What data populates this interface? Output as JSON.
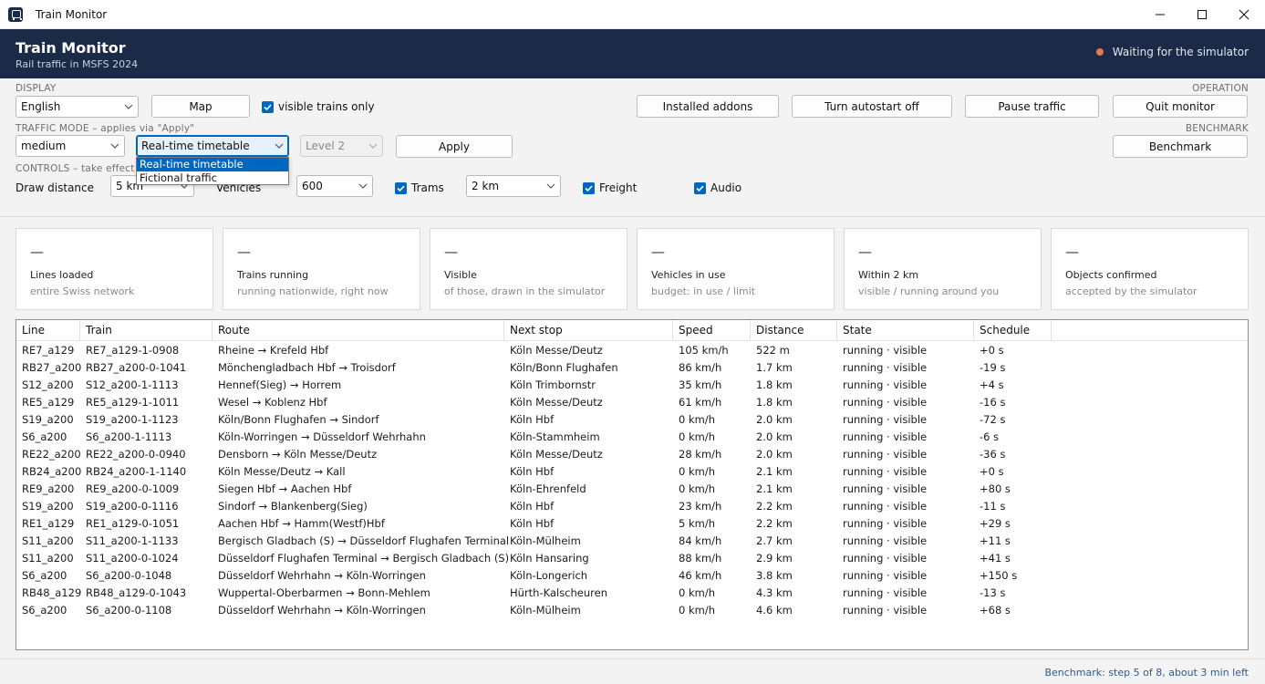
{
  "window": {
    "title": "Train Monitor"
  },
  "header": {
    "title": "Train Monitor",
    "subtitle": "Rail traffic in MSFS 2024",
    "status": "Waiting for the simulator",
    "status_color": "#e8774f",
    "background": "#1a2a47"
  },
  "display": {
    "section_label": "DISPLAY",
    "language": "English",
    "map_button": "Map",
    "visible_only_label": "visible trains only",
    "visible_only_checked": true
  },
  "operation": {
    "section_label": "OPERATION",
    "installed_addons": "Installed addons",
    "autostart": "Turn autostart off",
    "pause": "Pause traffic",
    "quit": "Quit monitor"
  },
  "benchmark": {
    "section_label": "BENCHMARK",
    "button": "Benchmark"
  },
  "traffic_mode": {
    "section_label": "TRAFFIC MODE – applies via \"Apply\"",
    "density": "medium",
    "mode": "Real-time timetable",
    "mode_options": [
      "Real-time timetable",
      "Fictional traffic"
    ],
    "level": "Level 2",
    "apply_button": "Apply"
  },
  "controls": {
    "section_label": "CONTROLS – take effect in",
    "draw_distance_label": "Draw distance",
    "draw_distance": "5 km",
    "vehicles_label": "Vehicles",
    "vehicles": "600",
    "trams_label": "Trams",
    "trams_checked": true,
    "radius": "2 km",
    "freight_label": "Freight",
    "freight_checked": true,
    "audio_label": "Audio",
    "audio_checked": true
  },
  "cards": [
    {
      "value": "—",
      "label": "Lines loaded",
      "sub": "entire Swiss network"
    },
    {
      "value": "—",
      "label": "Trains running",
      "sub": "running nationwide, right now"
    },
    {
      "value": "—",
      "label": "Visible",
      "sub": "of those, drawn in the simulator"
    },
    {
      "value": "—",
      "label": "Vehicles in use",
      "sub": "budget: in use / limit"
    },
    {
      "value": "—",
      "label": "Within 2 km",
      "sub": "visible / running around you"
    },
    {
      "value": "—",
      "label": "Objects confirmed",
      "sub": "accepted by the simulator"
    }
  ],
  "table": {
    "columns": [
      "Line",
      "Train",
      "Route",
      "Next stop",
      "Speed",
      "Distance",
      "State",
      "Schedule"
    ],
    "rows": [
      [
        "RE7_a129",
        "RE7_a129-1-0908",
        "Rheine → Krefeld Hbf",
        "Köln Messe/Deutz",
        "105 km/h",
        "522 m",
        "running · visible",
        "+0 s"
      ],
      [
        "RB27_a200",
        "RB27_a200-0-1041",
        "Mönchengladbach Hbf → Troisdorf",
        "Köln/Bonn Flughafen",
        "86 km/h",
        "1.7 km",
        "running · visible",
        "-19 s"
      ],
      [
        "S12_a200",
        "S12_a200-1-1113",
        "Hennef(Sieg) → Horrem",
        "Köln Trimbornstr",
        "35 km/h",
        "1.8 km",
        "running · visible",
        "+4 s"
      ],
      [
        "RE5_a129",
        "RE5_a129-1-1011",
        "Wesel → Koblenz Hbf",
        "Köln Messe/Deutz",
        "61 km/h",
        "1.8 km",
        "running · visible",
        "-16 s"
      ],
      [
        "S19_a200",
        "S19_a200-1-1123",
        "Köln/Bonn Flughafen → Sindorf",
        "Köln Hbf",
        "0 km/h",
        "2.0 km",
        "running · visible",
        "-72 s"
      ],
      [
        "S6_a200",
        "S6_a200-1-1113",
        "Köln-Worringen → Düsseldorf Wehrhahn",
        "Köln-Stammheim",
        "0 km/h",
        "2.0 km",
        "running · visible",
        "-6 s"
      ],
      [
        "RE22_a200",
        "RE22_a200-0-0940",
        "Densborn → Köln Messe/Deutz",
        "Köln Messe/Deutz",
        "28 km/h",
        "2.0 km",
        "running · visible",
        "-36 s"
      ],
      [
        "RB24_a200",
        "RB24_a200-1-1140",
        "Köln Messe/Deutz → Kall",
        "Köln Hbf",
        "0 km/h",
        "2.1 km",
        "running · visible",
        "+0 s"
      ],
      [
        "RE9_a200",
        "RE9_a200-0-1009",
        "Siegen Hbf → Aachen Hbf",
        "Köln-Ehrenfeld",
        "0 km/h",
        "2.1 km",
        "running · visible",
        "+80 s"
      ],
      [
        "S19_a200",
        "S19_a200-0-1116",
        "Sindorf → Blankenberg(Sieg)",
        "Köln Hbf",
        "23 km/h",
        "2.2 km",
        "running · visible",
        "-11 s"
      ],
      [
        "RE1_a129",
        "RE1_a129-0-1051",
        "Aachen Hbf → Hamm(Westf)Hbf",
        "Köln Hbf",
        "5 km/h",
        "2.2 km",
        "running · visible",
        "+29 s"
      ],
      [
        "S11_a200",
        "S11_a200-1-1133",
        "Bergisch Gladbach (S) → Düsseldorf Flughafen Terminal",
        "Köln-Mülheim",
        "84 km/h",
        "2.7 km",
        "running · visible",
        "+11 s"
      ],
      [
        "S11_a200",
        "S11_a200-0-1024",
        "Düsseldorf Flughafen Terminal → Bergisch Gladbach (S)",
        "Köln Hansaring",
        "88 km/h",
        "2.9 km",
        "running · visible",
        "+41 s"
      ],
      [
        "S6_a200",
        "S6_a200-0-1048",
        "Düsseldorf Wehrhahn → Köln-Worringen",
        "Köln-Longerich",
        "46 km/h",
        "3.8 km",
        "running · visible",
        "+150 s"
      ],
      [
        "RB48_a129",
        "RB48_a129-0-1043",
        "Wuppertal-Oberbarmen → Bonn-Mehlem",
        "Hürth-Kalscheuren",
        "0 km/h",
        "4.3 km",
        "running · visible",
        "-13 s"
      ],
      [
        "S6_a200",
        "S6_a200-0-1108",
        "Düsseldorf Wehrhahn → Köln-Worringen",
        "Köln-Mülheim",
        "0 km/h",
        "4.6 km",
        "running · visible",
        "+68 s"
      ]
    ]
  },
  "footer": {
    "status": "Benchmark: step 5 of 8, about 3 min left"
  }
}
